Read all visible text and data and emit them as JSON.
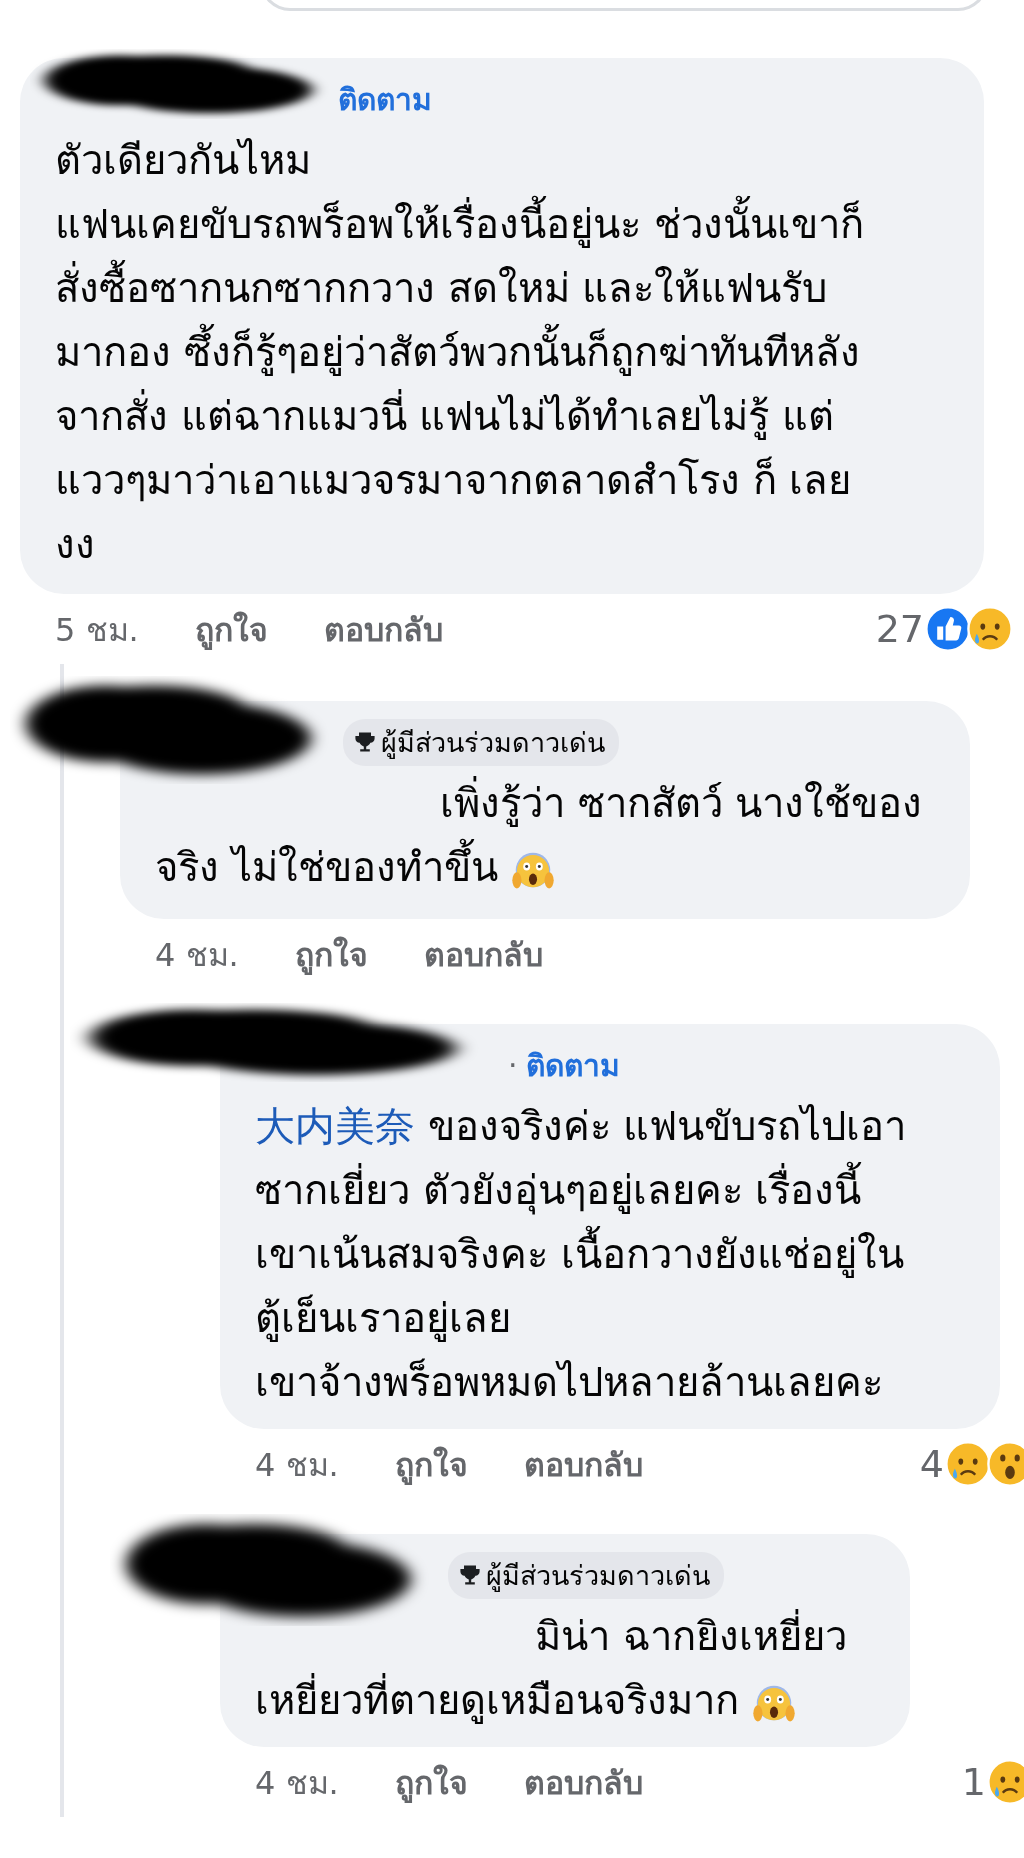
{
  "comments": [
    {
      "follow": "ติดตาม",
      "text": "ตัวเดียวกันไหม\nแฟนเคยขับรถพร็อพให้เรื่องนี้อยู่นะ ช่วงนั้นเขาก็\nสั่งซื้อซากนกซากกวาง สดใหม่ และให้แฟนรับ\nมากอง ซึ้งก็รู้ๆอยู่ว่าสัตว์พวกนั้นก็ถูกฆ่าทันทีหลัง\nจากสั่ง แต่ฉากแมวนี่ แฟนไม่ได้ทำเลยไม่รู้  แต่\nแววๆมาว่าเอาแมวจรมาจากตลาดสำโรง ก็ เลย\nงง",
      "time": "5 ชม.",
      "like": "ถูกใจ",
      "reply": "ตอบกลับ",
      "reaction_count": "27",
      "reactions": [
        {
          "kind": "like"
        },
        {
          "kind": "sad"
        }
      ],
      "children": [
        {
          "badge": "ผู้มีส่วนร่วมดาวเด่น",
          "text": "เพิ่งรู้ว่า ซากสัตว์ นางใช้ของ\nจริง ไม่ใช่ของทำขึ้น",
          "emoji": {
            "kind": "scream"
          },
          "time": "4 ชม.",
          "like": "ถูกใจ",
          "reply": "ตอบกลับ",
          "children": [
            {
              "separator": "·",
              "follow": "ติดตาม",
              "mention": "大内美奈",
              "text": "ของจริงค่ะ แฟนขับรถไปเอา\nซากเยี่ยว ตัวยังอุ่นๆอยู่เลยคะ เรื่องนี้\nเขาเน้นสมจริงคะ เนื้อกวางยังแช่อยู่ใน\nตู้เย็นเราอยู่เลย\nเขาจ้างพร็อพหมดไปหลายล้านเลยคะ",
              "time": "4 ชม.",
              "like": "ถูกใจ",
              "reply": "ตอบกลับ",
              "reaction_count": "4",
              "reactions": [
                {
                  "kind": "sad"
                },
                {
                  "kind": "wow"
                }
              ]
            },
            {
              "badge": "ผู้มีส่วนร่วมดาวเด่น",
              "text": "มิน่า ฉากยิงเหยี่ยว\nเหยี่ยวที่ตายดูเหมือนจริงมาก",
              "emoji": {
                "kind": "scream"
              },
              "time": "4 ชม.",
              "like": "ถูกใจ",
              "reply": "ตอบกลับ",
              "reaction_count": "1",
              "reactions": [
                {
                  "kind": "sad"
                }
              ]
            }
          ]
        }
      ]
    }
  ]
}
